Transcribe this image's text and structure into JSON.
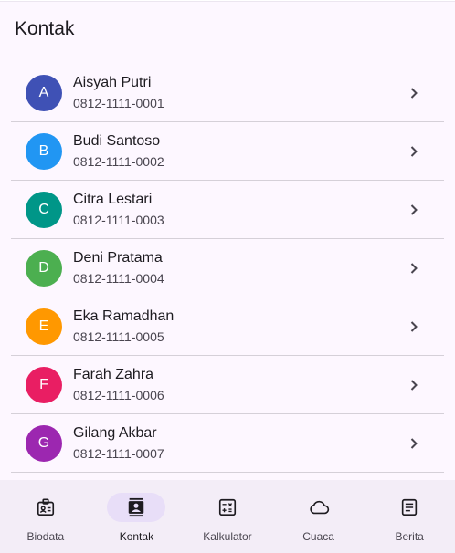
{
  "app_bar": {
    "title": "Kontak"
  },
  "contacts": [
    {
      "initial": "A",
      "name": "Aisyah Putri",
      "phone": "0812-1111-0001",
      "color": "#3f51b5"
    },
    {
      "initial": "B",
      "name": "Budi Santoso",
      "phone": "0812-1111-0002",
      "color": "#2196f3"
    },
    {
      "initial": "C",
      "name": "Citra Lestari",
      "phone": "0812-1111-0003",
      "color": "#009688"
    },
    {
      "initial": "D",
      "name": "Deni Pratama",
      "phone": "0812-1111-0004",
      "color": "#4caf50"
    },
    {
      "initial": "E",
      "name": "Eka Ramadhan",
      "phone": "0812-1111-0005",
      "color": "#ff9800"
    },
    {
      "initial": "F",
      "name": "Farah Zahra",
      "phone": "0812-1111-0006",
      "color": "#e91e63"
    },
    {
      "initial": "G",
      "name": "Gilang Akbar",
      "phone": "0812-1111-0007",
      "color": "#9c27b0"
    }
  ],
  "bottom_nav": {
    "items": [
      {
        "label": "Biodata",
        "icon": "badge-icon",
        "active": false
      },
      {
        "label": "Kontak",
        "icon": "contact-book-icon",
        "active": true
      },
      {
        "label": "Kalkulator",
        "icon": "calculator-icon",
        "active": false
      },
      {
        "label": "Cuaca",
        "icon": "cloud-icon",
        "active": false
      },
      {
        "label": "Berita",
        "icon": "article-icon",
        "active": false
      }
    ]
  },
  "colors": {
    "background": "#fdf7ff",
    "nav_background": "#f3edf7",
    "nav_active_pill": "#e8def8",
    "divider": "#d5d0d8"
  }
}
